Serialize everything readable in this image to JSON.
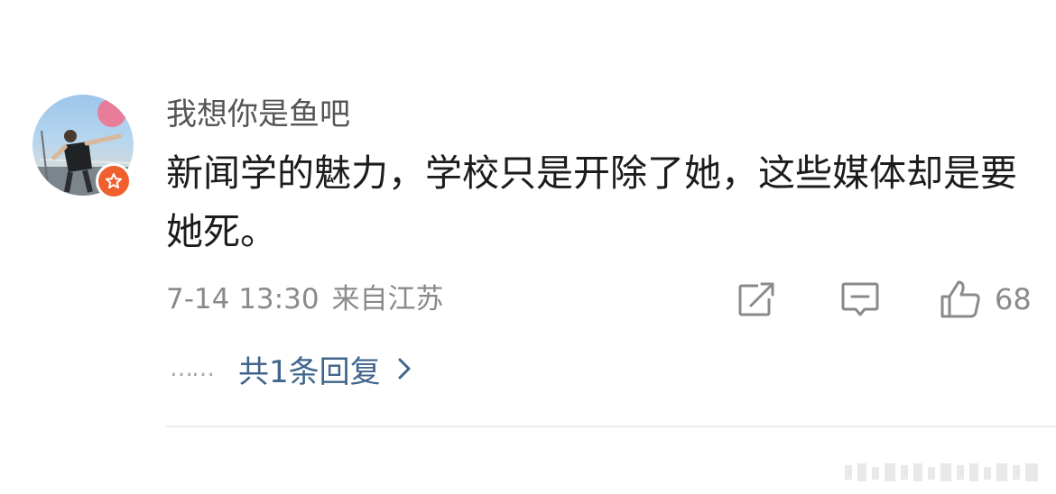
{
  "comment": {
    "username": "我想你是鱼吧",
    "text": "新闻学的魅力，学校只是开除了她，这些媒体却是要她死。",
    "date_time": "7-14 13:30",
    "location": "来自江苏",
    "like_count": "68",
    "replies_dots": "……",
    "replies_link": "共1条回复"
  },
  "icons": {
    "avatar": "avatar-photo",
    "badge": "verified-star-icon",
    "share": "share-icon",
    "comment": "comment-icon",
    "like": "thumbs-up-icon",
    "chevron": "chevron-right-icon"
  },
  "colors": {
    "username": "#555555",
    "text": "#1c1c1c",
    "meta": "#8a8a8a",
    "link": "#41658d",
    "badge": "#f0602e"
  }
}
